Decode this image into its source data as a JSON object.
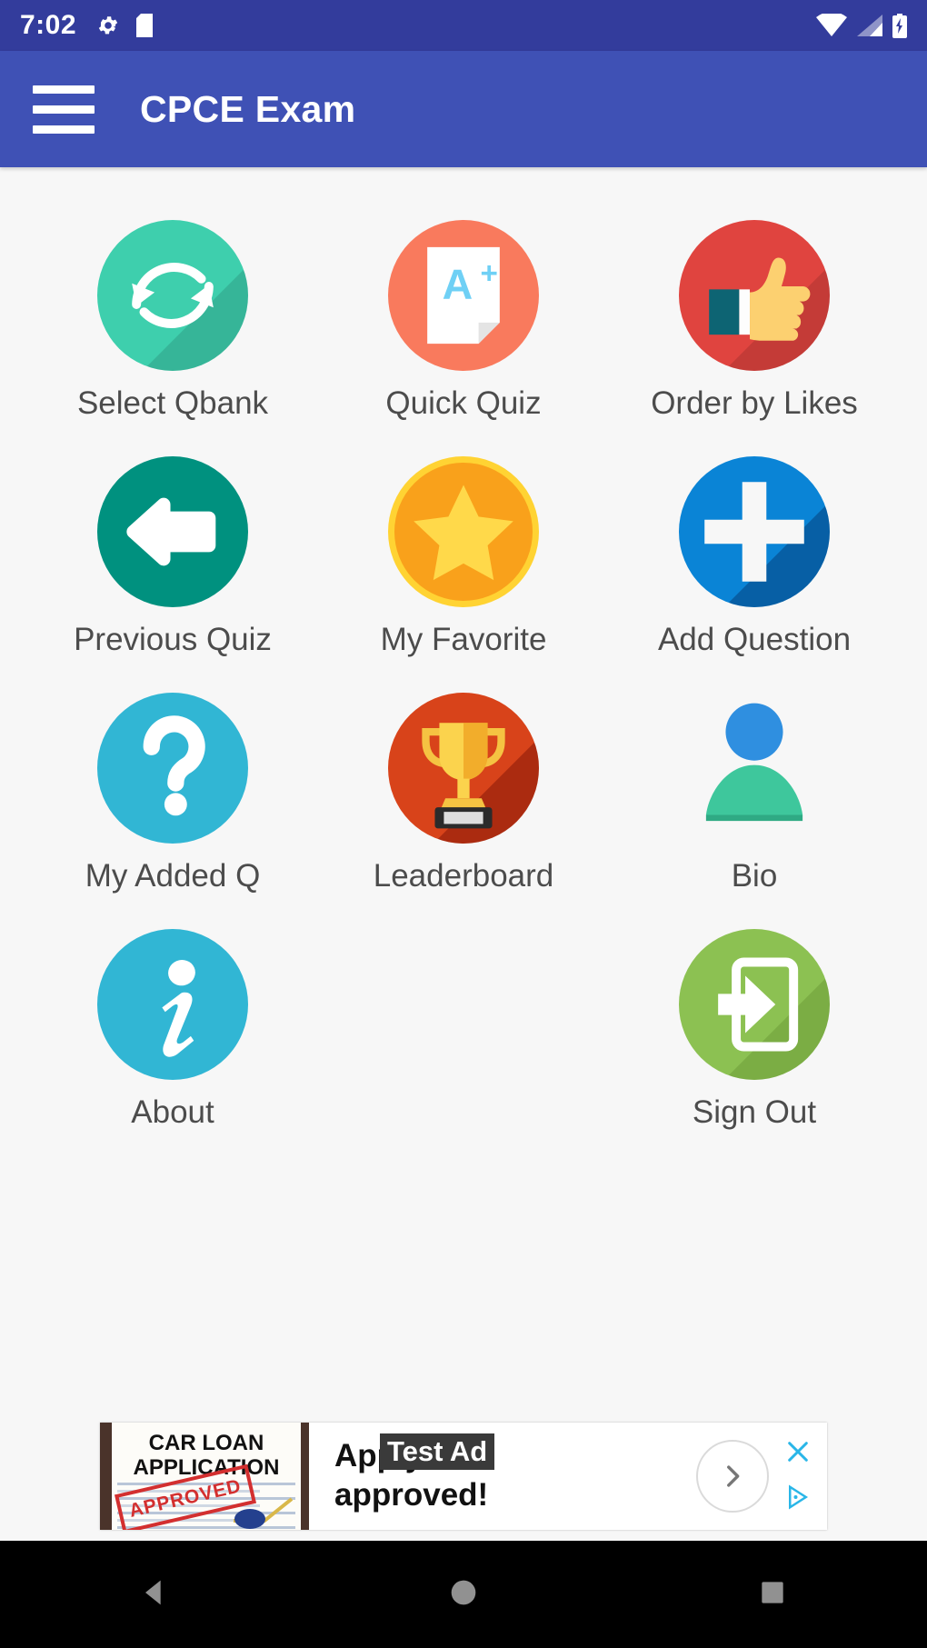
{
  "status_bar": {
    "time": "7:02",
    "icons": [
      "gear-icon",
      "sd-card-icon",
      "wifi-icon",
      "signal-icon",
      "battery-charging-icon"
    ],
    "background_color": "#333c9c"
  },
  "app_bar": {
    "menu_icon": "hamburger-menu-icon",
    "title": "CPCE Exam",
    "background_color": "#3f51b5"
  },
  "grid": {
    "items": [
      {
        "label": "Select Qbank",
        "icon": "sync-arrows-icon",
        "color": "#3ecfad"
      },
      {
        "label": "Quick Quiz",
        "icon": "a-plus-paper-icon",
        "color": "#f97a5d"
      },
      {
        "label": "Order by Likes",
        "icon": "thumbs-up-icon",
        "color": "#e0443f"
      },
      {
        "label": "Previous Quiz",
        "icon": "arrow-left-icon",
        "color": "#00917f"
      },
      {
        "label": "My Favorite",
        "icon": "star-badge-icon",
        "color": "#f9a11b"
      },
      {
        "label": "Add Question",
        "icon": "plus-icon",
        "color": "#0a84d6"
      },
      {
        "label": "My Added Q",
        "icon": "question-mark-icon",
        "color": "#31b6d4"
      },
      {
        "label": "Leaderboard",
        "icon": "trophy-icon",
        "color": "#d8431a"
      },
      {
        "label": "Bio",
        "icon": "person-avatar-icon",
        "color": "#3ec79c"
      },
      {
        "label": "About",
        "icon": "info-icon",
        "color": "#31b6d4"
      },
      {
        "label": "Sign Out",
        "icon": "exit-door-icon",
        "color": "#8cc152"
      }
    ]
  },
  "ad": {
    "image_line1": "CAR LOAN",
    "image_line2": "APPLICATION",
    "stamp": "APPROVED",
    "headline_line1": "Apply. Get",
    "headline_line2": "approved!",
    "badge": "Test Ad",
    "cta_icon": "chevron-right-icon",
    "close_icon": "close-x-icon",
    "adchoices_icon": "adchoices-icon"
  },
  "nav_bar": {
    "back": "back-triangle-icon",
    "home": "home-circle-icon",
    "recents": "recents-square-icon"
  }
}
